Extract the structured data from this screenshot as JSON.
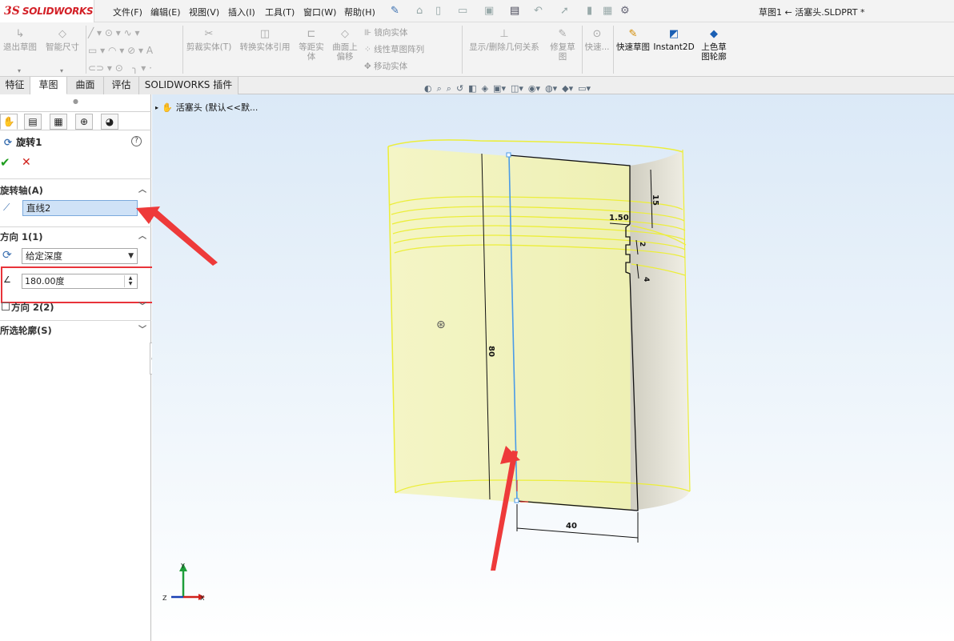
{
  "app": {
    "brand": "SOLIDWORKS",
    "brand_mark": "3S",
    "doc_title": "草图1 ← 活塞头.SLDPRT *"
  },
  "menus": [
    "文件(F)",
    "编辑(E)",
    "视图(V)",
    "插入(I)",
    "工具(T)",
    "窗口(W)",
    "帮助(H)"
  ],
  "toolbar": {
    "exit_sketch": "退出草图",
    "smart_dim": "智能尺寸",
    "trim": "剪裁实体(T)",
    "convert": "转换实体引用",
    "offset": "等距实体",
    "surface_offset": "曲面上偏移",
    "mirror": "镜向实体",
    "linear_pattern": "线性草图阵列",
    "move": "移动实体",
    "show_relations": "显示/删除几何关系",
    "repair": "修复草图",
    "quick_snaps": "快速...",
    "rapid_sketch": "快速草图",
    "instant2d": "Instant2D",
    "shaded_contours": "上色草图轮廓"
  },
  "tabs": [
    "特征",
    "草图",
    "曲面",
    "评估",
    "SOLIDWORKS 插件"
  ],
  "active_tab": "草图",
  "tree": {
    "root": "活塞头 (默认<<默..."
  },
  "feature": {
    "title": "旋转1",
    "help": "?",
    "axis_section": "旋转轴(A)",
    "axis_value": "直线2",
    "dir1_section": "方向 1(1)",
    "dir1_type": "给定深度",
    "angle": "180.00度",
    "dir2_section": "方向 2(2)",
    "contours_section": "所选轮廓(S)"
  },
  "dims": {
    "d15": "15",
    "d150": "1.50",
    "d2": "2",
    "d4": "4",
    "d80": "80",
    "d40": "40"
  },
  "triad": {
    "x": "X",
    "y": "Y",
    "z": "Z"
  },
  "colors": {
    "accent": "#e8333a",
    "body": "#f0f2b8",
    "edge": "#ecee3a",
    "axis": "#4a9be8"
  }
}
